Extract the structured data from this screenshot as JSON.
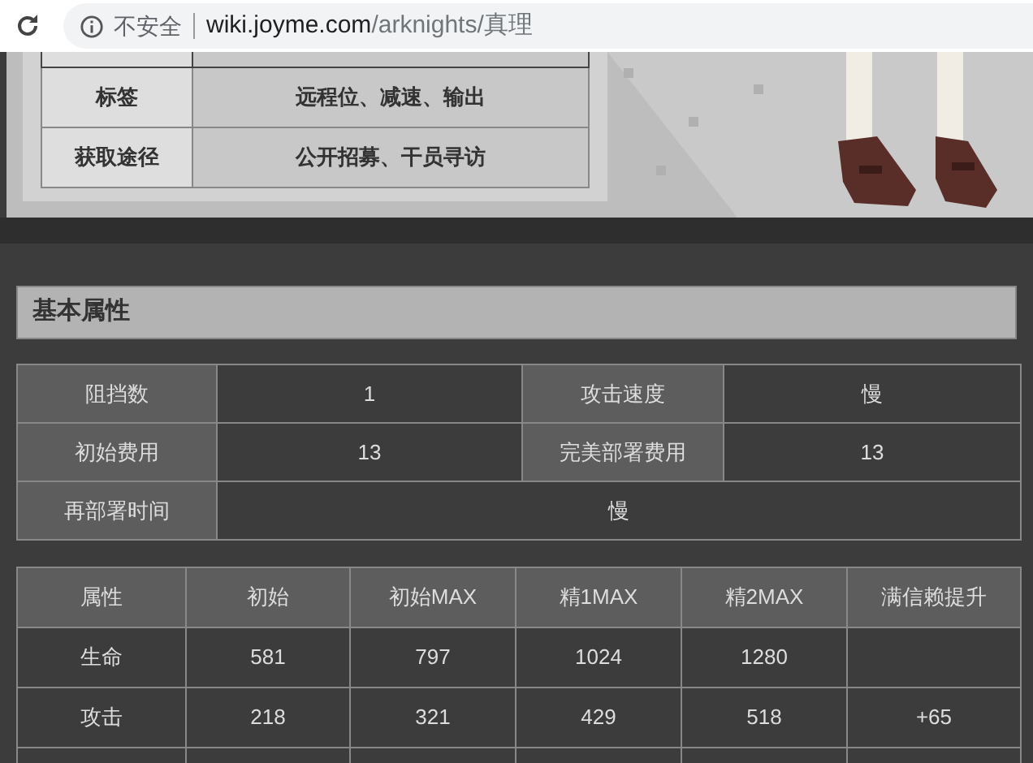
{
  "browser": {
    "security_label": "不安全",
    "url_host": "wiki.joyme.com",
    "url_path": "/arknights/真理"
  },
  "info_table": {
    "rows": [
      {
        "label": "标签",
        "value": "远程位、减速、输出"
      },
      {
        "label": "获取途径",
        "value": "公开招募、干员寻访"
      }
    ]
  },
  "section_title": "基本属性",
  "basic_stats": {
    "rows": [
      [
        {
          "label": "阻挡数",
          "value": "1"
        },
        {
          "label": "攻击速度",
          "value": "慢"
        }
      ],
      [
        {
          "label": "初始费用",
          "value": "13"
        },
        {
          "label": "完美部署费用",
          "value": "13"
        }
      ],
      [
        {
          "label": "再部署时间",
          "value": "慢"
        }
      ]
    ]
  },
  "attributes_table": {
    "columns": [
      "属性",
      "初始",
      "初始MAX",
      "精1MAX",
      "精2MAX",
      "满信赖提升"
    ],
    "rows": [
      [
        "生命",
        "581",
        "797",
        "1024",
        "1280"
      ],
      [
        "攻击",
        "218",
        "321",
        "429",
        "518",
        "+65"
      ]
    ]
  }
}
